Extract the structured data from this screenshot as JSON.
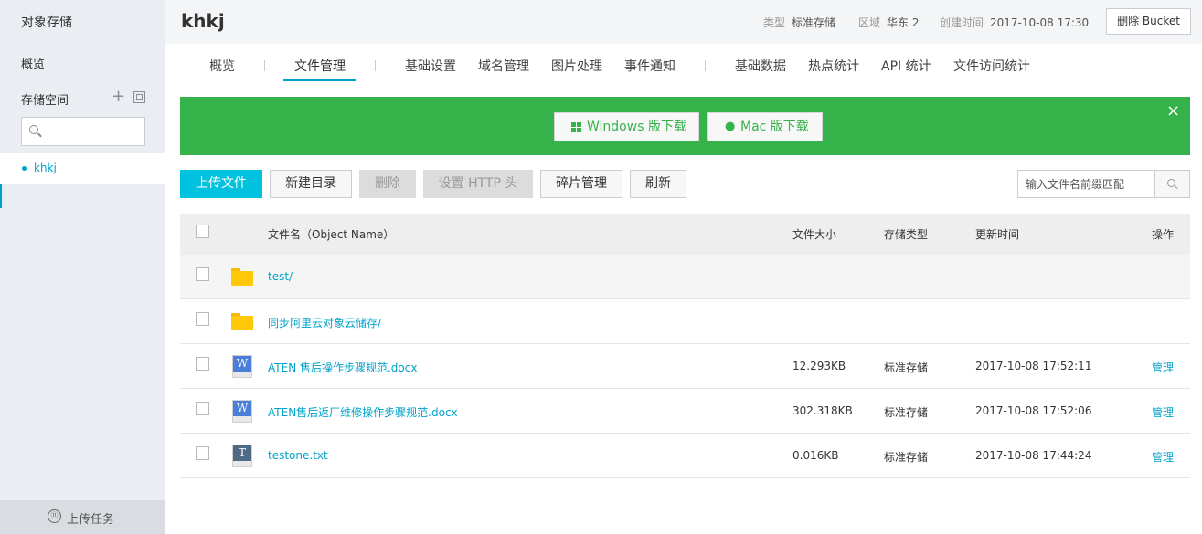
{
  "sidebar": {
    "title": "对象存储",
    "overview": "概览",
    "storage_space": "存储空间",
    "add_icon": "plus-icon",
    "search_placeholder": "",
    "buckets": [
      "khkj"
    ],
    "upload_tasks": "上传任务",
    "upload_tasks_icon_glyph": "⑪"
  },
  "header": {
    "bucket_name": "khkj",
    "type_label": "类型",
    "type_value": "标准存储",
    "region_label": "区域",
    "region_value": "华东 2",
    "created_label": "创建时间",
    "created_value": "2017-10-08 17:30",
    "delete_button": "删除 Bucket"
  },
  "tabs": [
    "概览",
    "文件管理",
    "基础设置",
    "域名管理",
    "图片处理",
    "事件通知",
    "基础数据",
    "热点统计",
    "API 统计",
    "文件访问统计"
  ],
  "active_tab": "文件管理",
  "banner": {
    "windows_download": "Windows 版下载",
    "mac_download": "Mac 版下载",
    "close_glyph": "×",
    "color": "#35b24a"
  },
  "toolbar": {
    "upload": "上传文件",
    "new_dir": "新建目录",
    "delete": "删除",
    "set_http_header": "设置 HTTP 头",
    "fragment_manage": "碎片管理",
    "refresh": "刷新",
    "search_placeholder": "输入文件名前缀匹配"
  },
  "table": {
    "headers": {
      "name": "文件名（Object Name）",
      "size": "文件大小",
      "storage_type": "存储类型",
      "updated": "更新时间",
      "action": "操作"
    },
    "rows": [
      {
        "kind": "folder",
        "name": "test/",
        "size": "",
        "storage_type": "",
        "updated": "",
        "action": ""
      },
      {
        "kind": "folder",
        "name": "同步阿里云对象云储存/",
        "size": "",
        "storage_type": "",
        "updated": "",
        "action": ""
      },
      {
        "kind": "word",
        "icon_letter": "W",
        "name": "ATEN 售后操作步骤规范.docx",
        "size": "12.293KB",
        "storage_type": "标准存储",
        "updated": "2017-10-08 17:52:11",
        "action": "管理"
      },
      {
        "kind": "word",
        "icon_letter": "W",
        "name": "ATEN售后返厂维修操作步骤规范.docx",
        "size": "302.318KB",
        "storage_type": "标准存储",
        "updated": "2017-10-08 17:52:06",
        "action": "管理"
      },
      {
        "kind": "txt",
        "icon_letter": "T",
        "name": "testone.txt",
        "size": "0.016KB",
        "storage_type": "标准存储",
        "updated": "2017-10-08 17:44:24",
        "action": "管理"
      }
    ]
  },
  "colors": {
    "accent": "#00a2ca",
    "primary_button": "#00c1de",
    "sidebar_bg": "#eaedf1"
  }
}
